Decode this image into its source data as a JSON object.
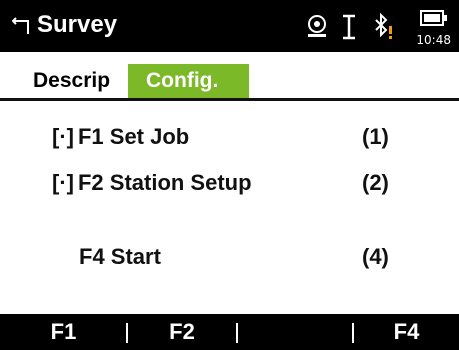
{
  "titlebar": {
    "title": "Survey",
    "time": "10:48",
    "icons": [
      "back-arrow-icon",
      "target-icon",
      "ibeam-icon",
      "bluetooth-warning-icon",
      "battery-icon"
    ]
  },
  "tabs": [
    {
      "label": "Descrip",
      "active": true
    },
    {
      "label": "Config.",
      "active": false
    }
  ],
  "menu": {
    "items": [
      {
        "bracket": "[·]",
        "label": "F1 Set Job",
        "key": "(1)"
      },
      {
        "bracket": "[·]",
        "label": "F2 Station Setup",
        "key": "(2)"
      },
      {
        "bracket": "",
        "label": "F4 Start",
        "key": "(4)"
      }
    ]
  },
  "fkeys": [
    "F1",
    "F2",
    "",
    "F4"
  ],
  "colors": {
    "bar": "#000000",
    "accent_tab": "#7bb928",
    "bluetooth_warning": "#f39c12"
  }
}
